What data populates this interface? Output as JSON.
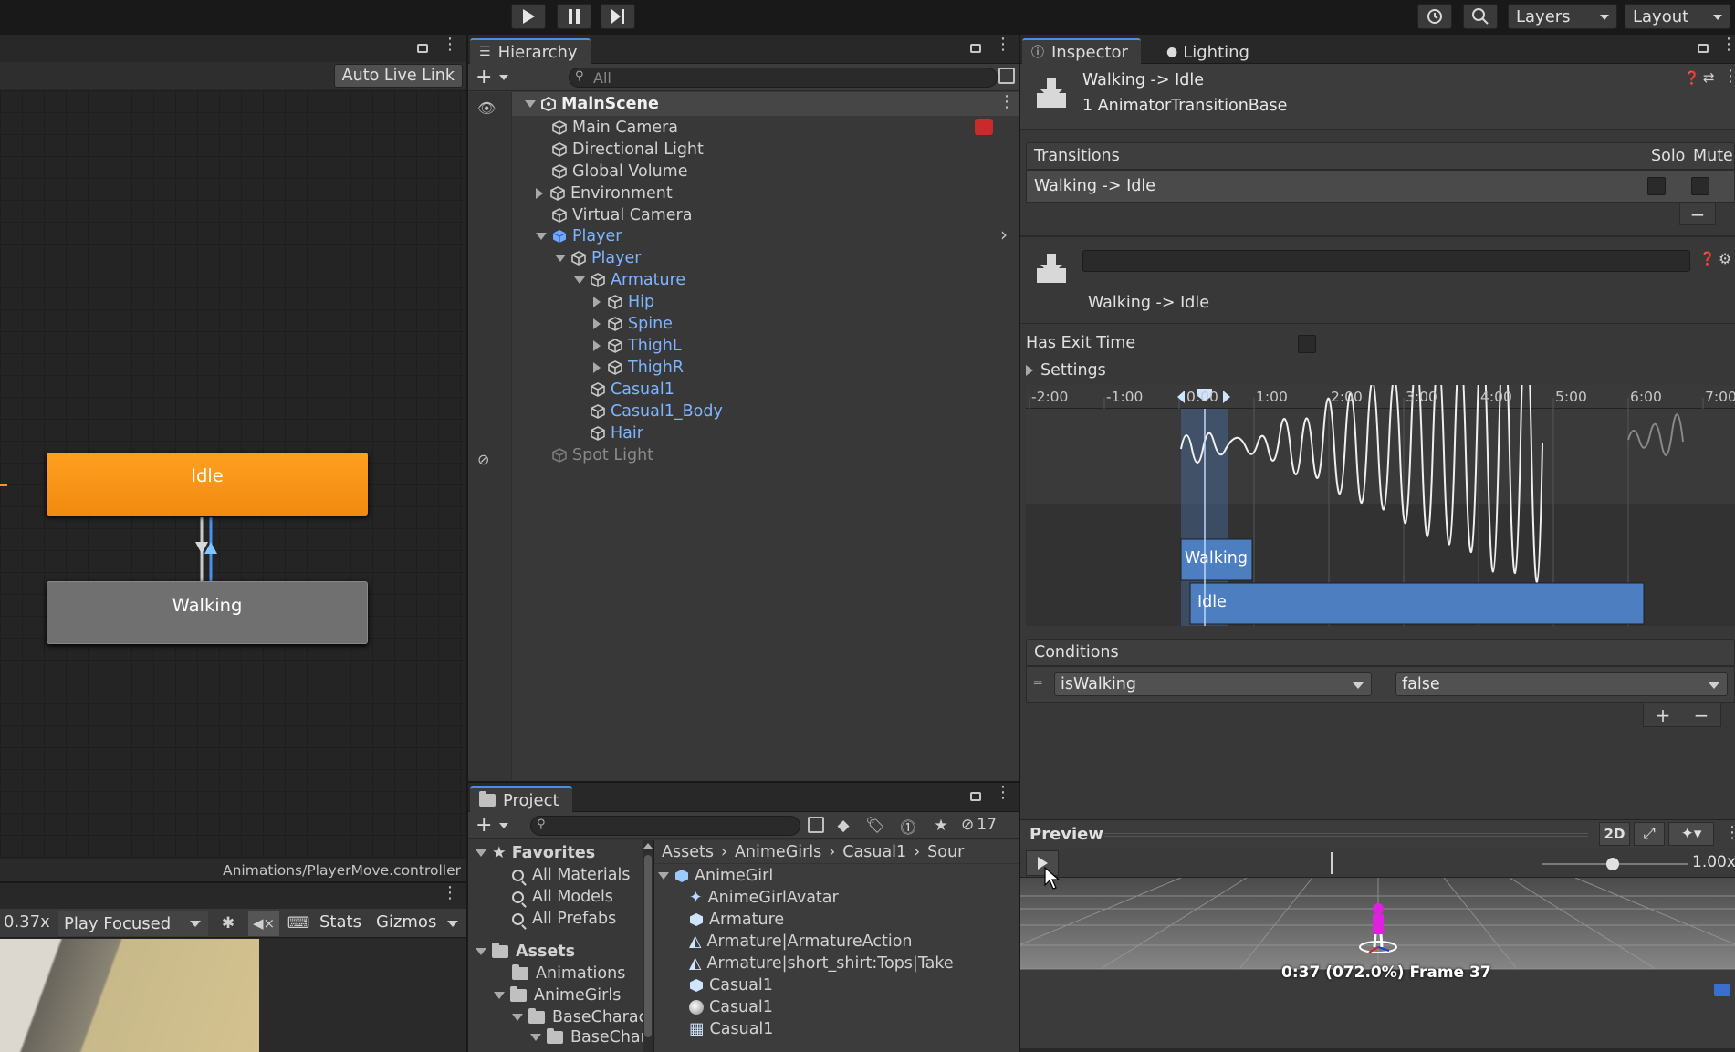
{
  "toolbar": {
    "play_icon": "play-icon",
    "pause_icon": "pause-icon",
    "step_icon": "step-icon",
    "layers_label": "Layers",
    "layout_label": "Layout"
  },
  "animator": {
    "auto_live_link": "Auto Live Link",
    "state_idle": "Idle",
    "state_walking": "Walking",
    "path": "Animations/PlayerMove.controller"
  },
  "game_view": {
    "scale": "0.37x",
    "play_mode": "Play Focused",
    "stats": "Stats",
    "gizmos": "Gizmos"
  },
  "hierarchy": {
    "tab": "Hierarchy",
    "search_placeholder": "All",
    "scene": "MainScene",
    "items": [
      {
        "label": "Main Camera"
      },
      {
        "label": "Directional Light"
      },
      {
        "label": "Global Volume"
      },
      {
        "label": "Environment"
      },
      {
        "label": "Virtual Camera"
      },
      {
        "label": "Player"
      },
      {
        "label": "Player"
      },
      {
        "label": "Armature"
      },
      {
        "label": "Hip"
      },
      {
        "label": "Spine"
      },
      {
        "label": "ThighL"
      },
      {
        "label": "ThighR"
      },
      {
        "label": "Casual1"
      },
      {
        "label": "Casual1_Body"
      },
      {
        "label": "Hair"
      },
      {
        "label": "Spot Light"
      }
    ]
  },
  "project": {
    "tab": "Project",
    "hidden_count": "17",
    "favorites_header": "Favorites",
    "favorites": [
      "All Materials",
      "All Models",
      "All Prefabs"
    ],
    "assets_header": "Assets",
    "tree": [
      "Animations",
      "AnimeGirls",
      "BaseCharacter",
      "BaseCharacte"
    ],
    "breadcrumb": [
      "Assets",
      "AnimeGirls",
      "Casual1",
      "Sour"
    ],
    "files": [
      "AnimeGirl",
      "AnimeGirlAvatar",
      "Armature",
      "Armature|ArmatureAction",
      "Armature|short_shirt:Tops|Take",
      "Casual1",
      "Casual1",
      "Casual1"
    ]
  },
  "inspector": {
    "tab": "Inspector",
    "tab2": "Lighting",
    "title": "Walking -> Idle",
    "subtitle": "1 AnimatorTransitionBase",
    "transitions_header": "Transitions",
    "solo": "Solo",
    "mute": "Mute",
    "transition_row": "Walking -> Idle",
    "detail_name": "Walking -> Idle",
    "has_exit_time": "Has Exit Time",
    "settings": "Settings",
    "timeline_ticks": [
      "-2:00",
      "-1:00",
      "0:00",
      "1:00",
      "2:00",
      "3:00",
      "4:00",
      "5:00",
      "6:00",
      "7:00"
    ],
    "clip_walking": "Walking",
    "clip_idle": "Idle",
    "conditions_header": "Conditions",
    "condition_param": "isWalking",
    "condition_value": "false",
    "preview_label": "Preview",
    "preview_2d": "2D",
    "preview_speed": "1.00x",
    "preview_frame": "0:37 (072.0%) Frame 37"
  },
  "colors": {
    "accent_blue": "#4a8fe0",
    "idle_orange": "#f7951e",
    "clip_blue": "#4d7fc0"
  }
}
